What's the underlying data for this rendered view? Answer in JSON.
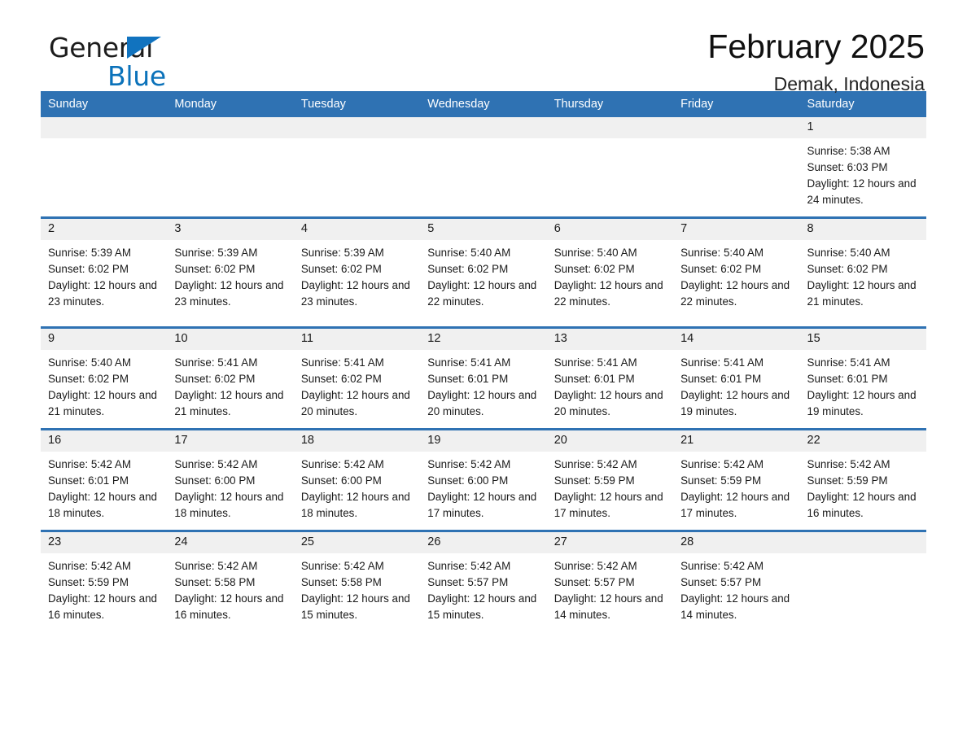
{
  "brand": {
    "name_part1": "General",
    "name_part2": "Blue",
    "triangle_color": "#1173bf",
    "blue_color": "#0b72ba"
  },
  "header": {
    "title": "February 2025",
    "subtitle": "Demak, Indonesia"
  },
  "theme": {
    "header_blue": "#2f72b3",
    "row_divider_blue": "#2f72b3",
    "daynum_band": "#f0f0f0",
    "text": "#1a1a1a"
  },
  "weekdays": [
    "Sunday",
    "Monday",
    "Tuesday",
    "Wednesday",
    "Thursday",
    "Friday",
    "Saturday"
  ],
  "labels": {
    "sunrise_prefix": "Sunrise:",
    "sunset_prefix": "Sunset:",
    "daylight_prefix": "Daylight:"
  },
  "weeks": [
    [
      {
        "day": "",
        "empty": true
      },
      {
        "day": "",
        "empty": true
      },
      {
        "day": "",
        "empty": true
      },
      {
        "day": "",
        "empty": true
      },
      {
        "day": "",
        "empty": true
      },
      {
        "day": "",
        "empty": true
      },
      {
        "day": "1",
        "sunrise": "Sunrise: 5:38 AM",
        "sunset": "Sunset: 6:03 PM",
        "daylight": "Daylight: 12 hours and 24 minutes."
      }
    ],
    [
      {
        "day": "2",
        "sunrise": "Sunrise: 5:39 AM",
        "sunset": "Sunset: 6:02 PM",
        "daylight": "Daylight: 12 hours and 23 minutes."
      },
      {
        "day": "3",
        "sunrise": "Sunrise: 5:39 AM",
        "sunset": "Sunset: 6:02 PM",
        "daylight": "Daylight: 12 hours and 23 minutes."
      },
      {
        "day": "4",
        "sunrise": "Sunrise: 5:39 AM",
        "sunset": "Sunset: 6:02 PM",
        "daylight": "Daylight: 12 hours and 23 minutes."
      },
      {
        "day": "5",
        "sunrise": "Sunrise: 5:40 AM",
        "sunset": "Sunset: 6:02 PM",
        "daylight": "Daylight: 12 hours and 22 minutes."
      },
      {
        "day": "6",
        "sunrise": "Sunrise: 5:40 AM",
        "sunset": "Sunset: 6:02 PM",
        "daylight": "Daylight: 12 hours and 22 minutes."
      },
      {
        "day": "7",
        "sunrise": "Sunrise: 5:40 AM",
        "sunset": "Sunset: 6:02 PM",
        "daylight": "Daylight: 12 hours and 22 minutes."
      },
      {
        "day": "8",
        "sunrise": "Sunrise: 5:40 AM",
        "sunset": "Sunset: 6:02 PM",
        "daylight": "Daylight: 12 hours and 21 minutes."
      }
    ],
    [
      {
        "day": "9",
        "sunrise": "Sunrise: 5:40 AM",
        "sunset": "Sunset: 6:02 PM",
        "daylight": "Daylight: 12 hours and 21 minutes."
      },
      {
        "day": "10",
        "sunrise": "Sunrise: 5:41 AM",
        "sunset": "Sunset: 6:02 PM",
        "daylight": "Daylight: 12 hours and 21 minutes."
      },
      {
        "day": "11",
        "sunrise": "Sunrise: 5:41 AM",
        "sunset": "Sunset: 6:02 PM",
        "daylight": "Daylight: 12 hours and 20 minutes."
      },
      {
        "day": "12",
        "sunrise": "Sunrise: 5:41 AM",
        "sunset": "Sunset: 6:01 PM",
        "daylight": "Daylight: 12 hours and 20 minutes."
      },
      {
        "day": "13",
        "sunrise": "Sunrise: 5:41 AM",
        "sunset": "Sunset: 6:01 PM",
        "daylight": "Daylight: 12 hours and 20 minutes."
      },
      {
        "day": "14",
        "sunrise": "Sunrise: 5:41 AM",
        "sunset": "Sunset: 6:01 PM",
        "daylight": "Daylight: 12 hours and 19 minutes."
      },
      {
        "day": "15",
        "sunrise": "Sunrise: 5:41 AM",
        "sunset": "Sunset: 6:01 PM",
        "daylight": "Daylight: 12 hours and 19 minutes."
      }
    ],
    [
      {
        "day": "16",
        "sunrise": "Sunrise: 5:42 AM",
        "sunset": "Sunset: 6:01 PM",
        "daylight": "Daylight: 12 hours and 18 minutes."
      },
      {
        "day": "17",
        "sunrise": "Sunrise: 5:42 AM",
        "sunset": "Sunset: 6:00 PM",
        "daylight": "Daylight: 12 hours and 18 minutes."
      },
      {
        "day": "18",
        "sunrise": "Sunrise: 5:42 AM",
        "sunset": "Sunset: 6:00 PM",
        "daylight": "Daylight: 12 hours and 18 minutes."
      },
      {
        "day": "19",
        "sunrise": "Sunrise: 5:42 AM",
        "sunset": "Sunset: 6:00 PM",
        "daylight": "Daylight: 12 hours and 17 minutes."
      },
      {
        "day": "20",
        "sunrise": "Sunrise: 5:42 AM",
        "sunset": "Sunset: 5:59 PM",
        "daylight": "Daylight: 12 hours and 17 minutes."
      },
      {
        "day": "21",
        "sunrise": "Sunrise: 5:42 AM",
        "sunset": "Sunset: 5:59 PM",
        "daylight": "Daylight: 12 hours and 17 minutes."
      },
      {
        "day": "22",
        "sunrise": "Sunrise: 5:42 AM",
        "sunset": "Sunset: 5:59 PM",
        "daylight": "Daylight: 12 hours and 16 minutes."
      }
    ],
    [
      {
        "day": "23",
        "sunrise": "Sunrise: 5:42 AM",
        "sunset": "Sunset: 5:59 PM",
        "daylight": "Daylight: 12 hours and 16 minutes."
      },
      {
        "day": "24",
        "sunrise": "Sunrise: 5:42 AM",
        "sunset": "Sunset: 5:58 PM",
        "daylight": "Daylight: 12 hours and 16 minutes."
      },
      {
        "day": "25",
        "sunrise": "Sunrise: 5:42 AM",
        "sunset": "Sunset: 5:58 PM",
        "daylight": "Daylight: 12 hours and 15 minutes."
      },
      {
        "day": "26",
        "sunrise": "Sunrise: 5:42 AM",
        "sunset": "Sunset: 5:57 PM",
        "daylight": "Daylight: 12 hours and 15 minutes."
      },
      {
        "day": "27",
        "sunrise": "Sunrise: 5:42 AM",
        "sunset": "Sunset: 5:57 PM",
        "daylight": "Daylight: 12 hours and 14 minutes."
      },
      {
        "day": "28",
        "sunrise": "Sunrise: 5:42 AM",
        "sunset": "Sunset: 5:57 PM",
        "daylight": "Daylight: 12 hours and 14 minutes."
      },
      {
        "day": "",
        "empty": true
      }
    ]
  ]
}
